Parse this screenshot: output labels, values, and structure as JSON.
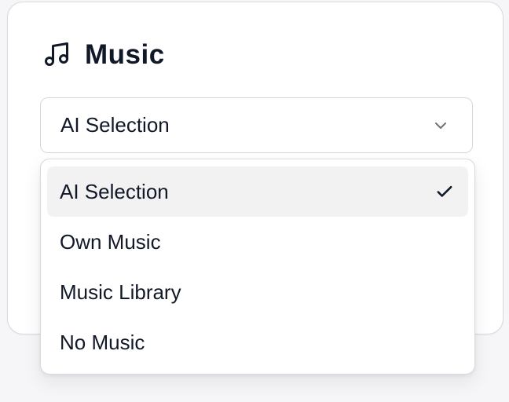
{
  "card": {
    "title": "Music",
    "icon": "music-note-icon"
  },
  "select": {
    "value": "AI Selection",
    "icon": "chevron-down-icon",
    "is_open": true
  },
  "dropdown": {
    "options": [
      {
        "label": "AI Selection",
        "selected": true,
        "icon": "check-icon"
      },
      {
        "label": "Own Music",
        "selected": false
      },
      {
        "label": "Music Library",
        "selected": false
      },
      {
        "label": "No Music",
        "selected": false
      }
    ]
  },
  "colors": {
    "page_background": "#f6f6f8",
    "card_background": "#ffffff",
    "border": "#d9d9de",
    "text_primary": "#111827",
    "selected_option_background": "#f2f2f3",
    "icon_stroke": "#111827",
    "chevron_stroke": "#6b7280"
  }
}
